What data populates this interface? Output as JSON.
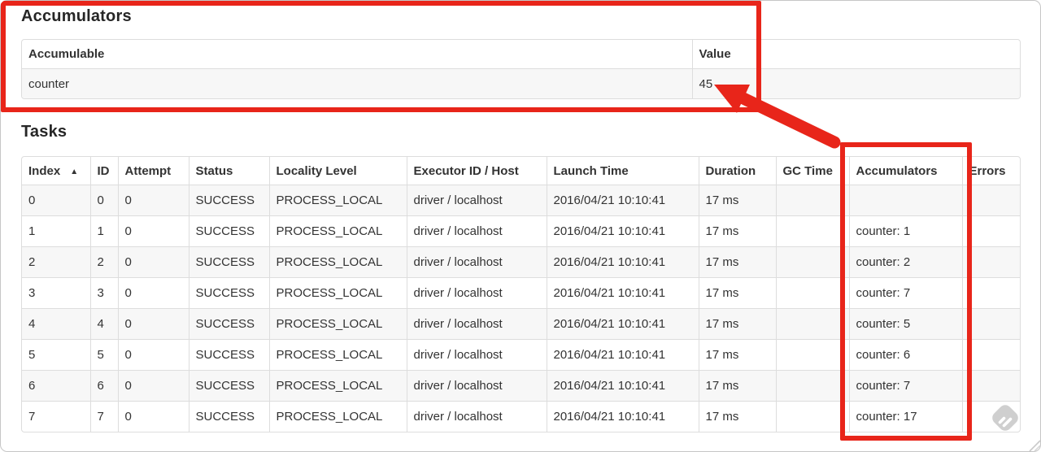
{
  "accumulators_section": {
    "title": "Accumulators",
    "table": {
      "headers": [
        "Accumulable",
        "Value"
      ],
      "rows": [
        {
          "accumulable": "counter",
          "value": "45"
        }
      ]
    }
  },
  "tasks_section": {
    "title": "Tasks",
    "table": {
      "headers": [
        "Index",
        "ID",
        "Attempt",
        "Status",
        "Locality Level",
        "Executor ID / Host",
        "Launch Time",
        "Duration",
        "GC Time",
        "Accumulators",
        "Errors"
      ],
      "sorted_column": "Index",
      "sort_indicator": "▲",
      "rows": [
        [
          "0",
          "0",
          "0",
          "SUCCESS",
          "PROCESS_LOCAL",
          "driver / localhost",
          "2016/04/21 10:10:41",
          "17 ms",
          "",
          "",
          ""
        ],
        [
          "1",
          "1",
          "0",
          "SUCCESS",
          "PROCESS_LOCAL",
          "driver / localhost",
          "2016/04/21 10:10:41",
          "17 ms",
          "",
          "counter: 1",
          ""
        ],
        [
          "2",
          "2",
          "0",
          "SUCCESS",
          "PROCESS_LOCAL",
          "driver / localhost",
          "2016/04/21 10:10:41",
          "17 ms",
          "",
          "counter: 2",
          ""
        ],
        [
          "3",
          "3",
          "0",
          "SUCCESS",
          "PROCESS_LOCAL",
          "driver / localhost",
          "2016/04/21 10:10:41",
          "17 ms",
          "",
          "counter: 7",
          ""
        ],
        [
          "4",
          "4",
          "0",
          "SUCCESS",
          "PROCESS_LOCAL",
          "driver / localhost",
          "2016/04/21 10:10:41",
          "17 ms",
          "",
          "counter: 5",
          ""
        ],
        [
          "5",
          "5",
          "0",
          "SUCCESS",
          "PROCESS_LOCAL",
          "driver / localhost",
          "2016/04/21 10:10:41",
          "17 ms",
          "",
          "counter: 6",
          ""
        ],
        [
          "6",
          "6",
          "0",
          "SUCCESS",
          "PROCESS_LOCAL",
          "driver / localhost",
          "2016/04/21 10:10:41",
          "17 ms",
          "",
          "counter: 7",
          ""
        ],
        [
          "7",
          "7",
          "0",
          "SUCCESS",
          "PROCESS_LOCAL",
          "driver / localhost",
          "2016/04/21 10:10:41",
          "17 ms",
          "",
          "counter: 17",
          ""
        ]
      ]
    }
  },
  "annotations": {
    "highlight_color": "#e8251a",
    "box_1_target": "Accumulators summary table",
    "box_2_target": "Accumulators column",
    "arrow_points_to": "45"
  },
  "colors": {
    "table_border": "#dddddd",
    "row_stripe": "#f7f7f7",
    "text": "#333333"
  }
}
